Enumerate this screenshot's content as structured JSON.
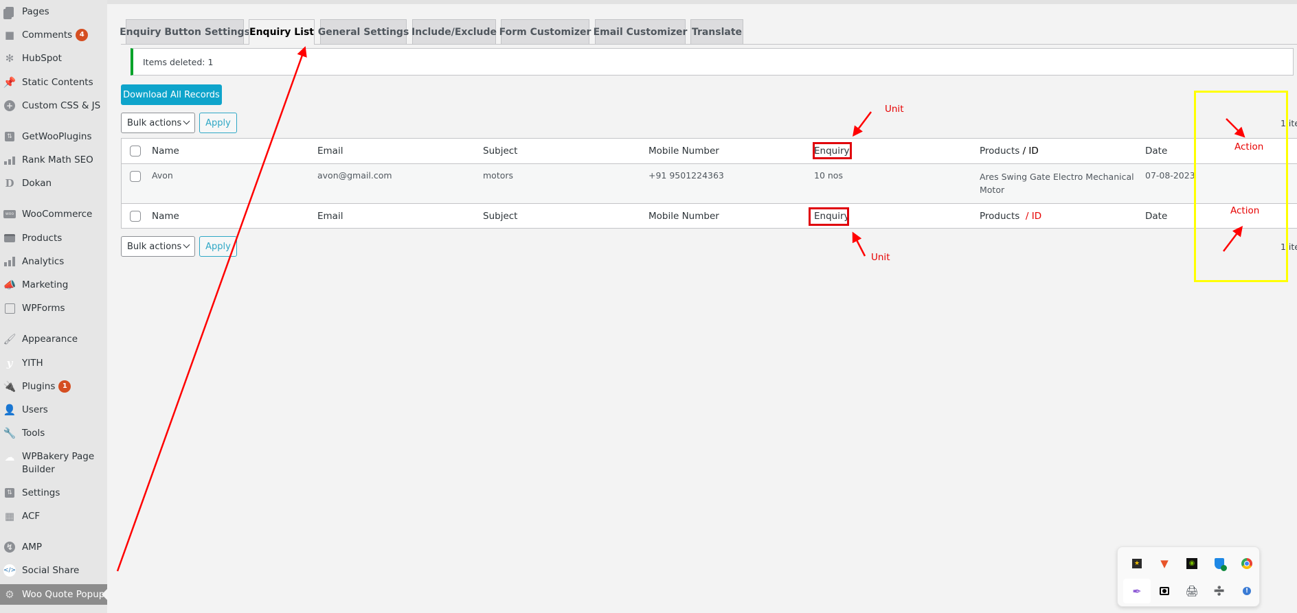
{
  "sidebar": {
    "items": [
      {
        "label": "Pages",
        "icon": "pages-icon"
      },
      {
        "label": "Comments",
        "icon": "comment-icon",
        "badge": "4"
      },
      {
        "label": "HubSpot",
        "icon": "hubspot-icon"
      },
      {
        "label": "Static Contents",
        "icon": "pin-icon"
      },
      {
        "label": "Custom CSS & JS",
        "icon": "plus-circle-icon"
      },
      {
        "label": "GetWooPlugins",
        "icon": "sliders-icon"
      },
      {
        "label": "Rank Math SEO",
        "icon": "rank-math-icon"
      },
      {
        "label": "Dokan",
        "icon": "dokan-icon"
      },
      {
        "label": "WooCommerce",
        "icon": "woo-icon"
      },
      {
        "label": "Products",
        "icon": "archive-icon"
      },
      {
        "label": "Analytics",
        "icon": "bar-chart-icon"
      },
      {
        "label": "Marketing",
        "icon": "megaphone-icon"
      },
      {
        "label": "WPForms",
        "icon": "form-icon"
      },
      {
        "label": "Appearance",
        "icon": "paintbrush-icon"
      },
      {
        "label": "YITH",
        "icon": "yith-icon"
      },
      {
        "label": "Plugins",
        "icon": "plug-icon",
        "badge": "1"
      },
      {
        "label": "Users",
        "icon": "user-icon"
      },
      {
        "label": "Tools",
        "icon": "wrench-icon"
      },
      {
        "label": "WPBakery Page Builder",
        "icon": "cloud-icon"
      },
      {
        "label": "Settings",
        "icon": "sliders-icon"
      },
      {
        "label": "ACF",
        "icon": "table-icon"
      },
      {
        "label": "AMP",
        "icon": "bolt-circle-icon"
      },
      {
        "label": "Social Share",
        "icon": "code-icon"
      },
      {
        "label": "Woo Quote Popup",
        "icon": "gear-icon",
        "active": true
      }
    ]
  },
  "tabs": [
    {
      "label": "Enquiry Button Settings"
    },
    {
      "label": "Enquiry List",
      "active": true
    },
    {
      "label": "General Settings"
    },
    {
      "label": "Include/Exclude"
    },
    {
      "label": "Form Customizer"
    },
    {
      "label": "Email Customizer"
    },
    {
      "label": "Translate"
    }
  ],
  "notice": {
    "text": "Items deleted: 1",
    "color": "#00a32a"
  },
  "download_button": "Download All Records",
  "bulk_actions": {
    "selected": "Bulk actions",
    "apply_label": "Apply"
  },
  "item_count": "1 ite",
  "table": {
    "columns": [
      "Name",
      "Email",
      "Subject",
      "Mobile Number",
      "Enquiry",
      "Products",
      "Date"
    ],
    "header_products_suffix": "/ ID",
    "rows": [
      {
        "name": "Avon",
        "email": "avon@gmail.com",
        "subject": "motors",
        "mobile": "+91 9501224363",
        "enquiry": "10 nos",
        "products": "Ares Swing Gate Electro Mechanical Motor",
        "date": "07-08-2023"
      }
    ]
  },
  "annotations": {
    "unit_top": "Unit",
    "unit_bottom": "Unit",
    "action_top": "Action",
    "action_bottom": "Action",
    "footer_id_suffix": "/ ID",
    "color_red": "#e60000",
    "color_yellow": "#ffff00"
  },
  "tray": {
    "icons": [
      "app-star-icon",
      "v-logo-icon",
      "nvidia-icon",
      "windows-security-icon",
      "chrome-icon",
      "feather-icon",
      "record-icon",
      "printer-icon",
      "scanner-icon",
      "network-help-icon"
    ]
  }
}
